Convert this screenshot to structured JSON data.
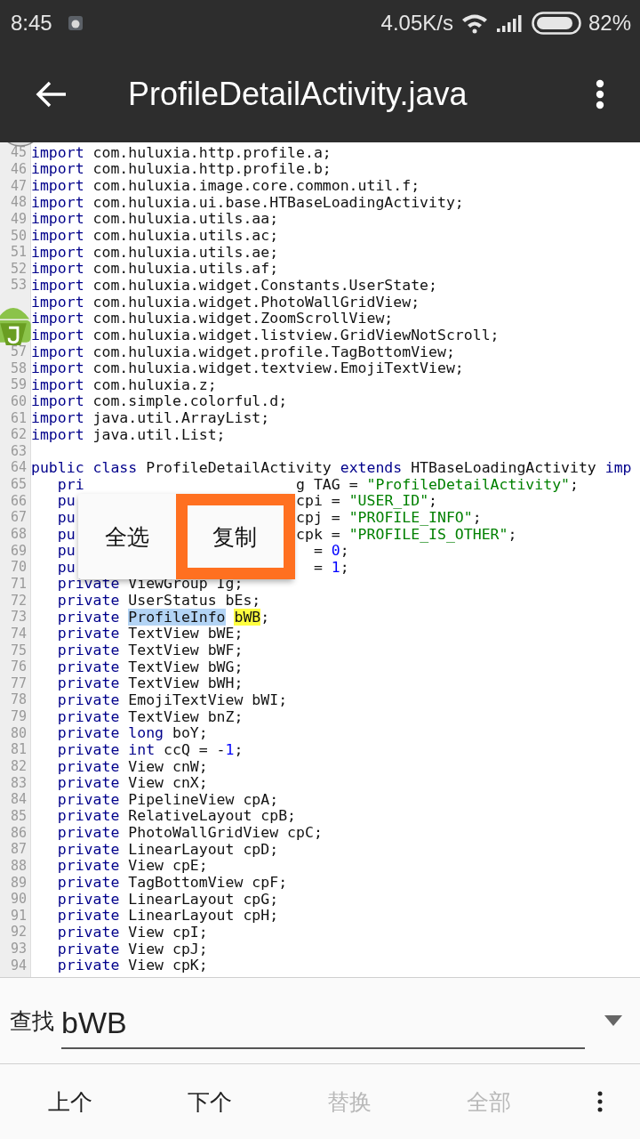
{
  "status_bar": {
    "time": "8:45",
    "speed": "4.05K/s",
    "battery": "82%"
  },
  "toolbar": {
    "title": "ProfileDetailActivity.java"
  },
  "code": {
    "lines": [
      {
        "number": "45",
        "tokens": [
          {
            "kind": "kw",
            "text": "import"
          },
          {
            "kind": "plain",
            "text": " com.huluxia.http.profile.a;"
          }
        ]
      },
      {
        "number": "46",
        "tokens": [
          {
            "kind": "kw",
            "text": "import"
          },
          {
            "kind": "plain",
            "text": " com.huluxia.http.profile.b;"
          }
        ]
      },
      {
        "number": "47",
        "tokens": [
          {
            "kind": "kw",
            "text": "import"
          },
          {
            "kind": "plain",
            "text": " com.huluxia.image.core.common.util.f;"
          }
        ]
      },
      {
        "number": "48",
        "tokens": [
          {
            "kind": "kw",
            "text": "import"
          },
          {
            "kind": "plain",
            "text": " com.huluxia.ui.base.HTBaseLoadingActivity;"
          }
        ]
      },
      {
        "number": "49",
        "tokens": [
          {
            "kind": "kw",
            "text": "import"
          },
          {
            "kind": "plain",
            "text": " com.huluxia.utils.aa;"
          }
        ]
      },
      {
        "number": "50",
        "tokens": [
          {
            "kind": "kw",
            "text": "import"
          },
          {
            "kind": "plain",
            "text": " com.huluxia.utils.ac;"
          }
        ]
      },
      {
        "number": "51",
        "tokens": [
          {
            "kind": "kw",
            "text": "import"
          },
          {
            "kind": "plain",
            "text": " com.huluxia.utils.ae;"
          }
        ]
      },
      {
        "number": "52",
        "tokens": [
          {
            "kind": "kw",
            "text": "import"
          },
          {
            "kind": "plain",
            "text": " com.huluxia.utils.af;"
          }
        ]
      },
      {
        "number": "53",
        "tokens": [
          {
            "kind": "kw",
            "text": "import"
          },
          {
            "kind": "plain",
            "text": " com.huluxia.widget.Constants.UserState;"
          }
        ]
      },
      {
        "tokens": [
          {
            "kind": "kw",
            "text": "import"
          },
          {
            "kind": "plain",
            "text": " com.huluxia.widget.PhotoWallGridView;"
          }
        ]
      },
      {
        "tokens": [
          {
            "kind": "kw",
            "text": "import"
          },
          {
            "kind": "plain",
            "text": " com.huluxia.widget.ZoomScrollView;"
          }
        ]
      },
      {
        "tokens": [
          {
            "kind": "kw",
            "text": "import"
          },
          {
            "kind": "plain",
            "text": " com.huluxia.widget.listview.GridViewNotScroll;"
          }
        ]
      },
      {
        "number": "57",
        "tokens": [
          {
            "kind": "kw",
            "text": "import"
          },
          {
            "kind": "plain",
            "text": " com.huluxia.widget.profile.TagBottomView;"
          }
        ]
      },
      {
        "number": "58",
        "tokens": [
          {
            "kind": "kw",
            "text": "import"
          },
          {
            "kind": "plain",
            "text": " com.huluxia.widget.textview.EmojiTextView;"
          }
        ]
      },
      {
        "number": "59",
        "tokens": [
          {
            "kind": "kw",
            "text": "import"
          },
          {
            "kind": "plain",
            "text": " com.huluxia.z;"
          }
        ]
      },
      {
        "number": "60",
        "tokens": [
          {
            "kind": "kw",
            "text": "import"
          },
          {
            "kind": "plain",
            "text": " com.simple.colorful.d;"
          }
        ]
      },
      {
        "number": "61",
        "tokens": [
          {
            "kind": "kw",
            "text": "import"
          },
          {
            "kind": "plain",
            "text": " java.util.ArrayList;"
          }
        ]
      },
      {
        "number": "62",
        "tokens": [
          {
            "kind": "kw",
            "text": "import"
          },
          {
            "kind": "plain",
            "text": " java.util.List;"
          }
        ]
      },
      {
        "number": "63"
      },
      {
        "number": "64",
        "tokens": [
          {
            "kind": "kw",
            "text": "public class"
          },
          {
            "kind": "plain",
            "text": " ProfileDetailActivity "
          },
          {
            "kind": "kw",
            "text": "extends"
          },
          {
            "kind": "plain",
            "text": " HTBaseLoadingActivity "
          },
          {
            "kind": "kw",
            "text": "imp"
          }
        ]
      },
      {
        "number": "65",
        "tokens": [
          {
            "kind": "kw",
            "text": "   pri"
          },
          {
            "kind": "plain",
            "text": "                        g TAG = "
          },
          {
            "kind": "str",
            "text": "\"ProfileDetailActivity\""
          },
          {
            "kind": "plain",
            "text": ";"
          }
        ]
      },
      {
        "number": "66",
        "tokens": [
          {
            "kind": "kw",
            "text": "   pu"
          },
          {
            "kind": "plain",
            "text": "                         cpi = "
          },
          {
            "kind": "str",
            "text": "\"USER_ID\""
          },
          {
            "kind": "plain",
            "text": ";"
          }
        ]
      },
      {
        "number": "67",
        "tokens": [
          {
            "kind": "kw",
            "text": "   pu"
          },
          {
            "kind": "plain",
            "text": "                         cpj = "
          },
          {
            "kind": "str",
            "text": "\"PROFILE_INFO\""
          },
          {
            "kind": "plain",
            "text": ";"
          }
        ]
      },
      {
        "number": "68",
        "tokens": [
          {
            "kind": "kw",
            "text": "   pu"
          },
          {
            "kind": "plain",
            "text": "                         cpk = "
          },
          {
            "kind": "str",
            "text": "\"PROFILE_IS_OTHER\""
          },
          {
            "kind": "plain",
            "text": ";"
          }
        ]
      },
      {
        "number": "69",
        "tokens": [
          {
            "kind": "kw",
            "text": "   pu"
          },
          {
            "kind": "plain",
            "text": "                           = "
          },
          {
            "kind": "num",
            "text": "0"
          },
          {
            "kind": "plain",
            "text": ";"
          }
        ]
      },
      {
        "number": "70",
        "tokens": [
          {
            "kind": "kw",
            "text": "   pu"
          },
          {
            "kind": "plain",
            "text": "                           = "
          },
          {
            "kind": "num",
            "text": "1"
          },
          {
            "kind": "plain",
            "text": ";"
          }
        ]
      },
      {
        "number": "71",
        "tokens": [
          {
            "kind": "kw",
            "text": "   private"
          },
          {
            "kind": "plain",
            "text": " ViewGroup Ig;"
          }
        ]
      },
      {
        "number": "72",
        "tokens": [
          {
            "kind": "kw",
            "text": "   private"
          },
          {
            "kind": "plain",
            "text": " UserStatus bEs;"
          }
        ]
      },
      {
        "number": "73",
        "tokens": [
          {
            "kind": "kw",
            "text": "   private "
          },
          {
            "kind": "selected",
            "text": "ProfileInfo"
          },
          {
            "kind": "match",
            "text": "bWB"
          },
          {
            "kind": "plain",
            "text": ";"
          }
        ]
      },
      {
        "number": "74",
        "tokens": [
          {
            "kind": "kw",
            "text": "   private"
          },
          {
            "kind": "plain",
            "text": " TextView bWE;"
          }
        ]
      },
      {
        "number": "75",
        "tokens": [
          {
            "kind": "kw",
            "text": "   private"
          },
          {
            "kind": "plain",
            "text": " TextView bWF;"
          }
        ]
      },
      {
        "number": "76",
        "tokens": [
          {
            "kind": "kw",
            "text": "   private"
          },
          {
            "kind": "plain",
            "text": " TextView bWG;"
          }
        ]
      },
      {
        "number": "77",
        "tokens": [
          {
            "kind": "kw",
            "text": "   private"
          },
          {
            "kind": "plain",
            "text": " TextView bWH;"
          }
        ]
      },
      {
        "number": "78",
        "tokens": [
          {
            "kind": "kw",
            "text": "   private"
          },
          {
            "kind": "plain",
            "text": " EmojiTextView bWI;"
          }
        ]
      },
      {
        "number": "79",
        "tokens": [
          {
            "kind": "kw",
            "text": "   private"
          },
          {
            "kind": "plain",
            "text": " TextView bnZ;"
          }
        ]
      },
      {
        "number": "80",
        "tokens": [
          {
            "kind": "kw",
            "text": "   private long"
          },
          {
            "kind": "plain",
            "text": " boY;"
          }
        ]
      },
      {
        "number": "81",
        "tokens": [
          {
            "kind": "kw",
            "text": "   private int"
          },
          {
            "kind": "plain",
            "text": " ccQ = -"
          },
          {
            "kind": "num",
            "text": "1"
          },
          {
            "kind": "plain",
            "text": ";"
          }
        ]
      },
      {
        "number": "82",
        "tokens": [
          {
            "kind": "kw",
            "text": "   private"
          },
          {
            "kind": "plain",
            "text": " View cnW;"
          }
        ]
      },
      {
        "number": "83",
        "tokens": [
          {
            "kind": "kw",
            "text": "   private"
          },
          {
            "kind": "plain",
            "text": " View cnX;"
          }
        ]
      },
      {
        "number": "84",
        "tokens": [
          {
            "kind": "kw",
            "text": "   private"
          },
          {
            "kind": "plain",
            "text": " PipelineView cpA;"
          }
        ]
      },
      {
        "number": "85",
        "tokens": [
          {
            "kind": "kw",
            "text": "   private"
          },
          {
            "kind": "plain",
            "text": " RelativeLayout cpB;"
          }
        ]
      },
      {
        "number": "86",
        "tokens": [
          {
            "kind": "kw",
            "text": "   private"
          },
          {
            "kind": "plain",
            "text": " PhotoWallGridView cpC;"
          }
        ]
      },
      {
        "number": "87",
        "tokens": [
          {
            "kind": "kw",
            "text": "   private"
          },
          {
            "kind": "plain",
            "text": " LinearLayout cpD;"
          }
        ]
      },
      {
        "number": "88",
        "tokens": [
          {
            "kind": "kw",
            "text": "   private"
          },
          {
            "kind": "plain",
            "text": " View cpE;"
          }
        ]
      },
      {
        "number": "89",
        "tokens": [
          {
            "kind": "kw",
            "text": "   private"
          },
          {
            "kind": "plain",
            "text": " TagBottomView cpF;"
          }
        ]
      },
      {
        "number": "90",
        "tokens": [
          {
            "kind": "kw",
            "text": "   private"
          },
          {
            "kind": "plain",
            "text": " LinearLayout cpG;"
          }
        ]
      },
      {
        "number": "91",
        "tokens": [
          {
            "kind": "kw",
            "text": "   private"
          },
          {
            "kind": "plain",
            "text": " LinearLayout cpH;"
          }
        ]
      },
      {
        "number": "92",
        "tokens": [
          {
            "kind": "kw",
            "text": "   private"
          },
          {
            "kind": "plain",
            "text": " View cpI;"
          }
        ]
      },
      {
        "number": "93",
        "tokens": [
          {
            "kind": "kw",
            "text": "   private"
          },
          {
            "kind": "plain",
            "text": " View cpJ;"
          }
        ]
      },
      {
        "number": "94",
        "tokens": [
          {
            "kind": "kw",
            "text": "   private"
          },
          {
            "kind": "plain",
            "text": " View cpK;"
          }
        ]
      }
    ]
  },
  "context_menu": {
    "items": [
      {
        "label": "全选",
        "highlighted": false
      },
      {
        "label": "复制",
        "highlighted": true
      }
    ]
  },
  "find_bar": {
    "label": "查找",
    "value": "bWB"
  },
  "actions": [
    {
      "label": "上个",
      "disabled": false
    },
    {
      "label": "下个",
      "disabled": false
    },
    {
      "label": "替换",
      "disabled": true
    },
    {
      "label": "全部",
      "disabled": true
    }
  ]
}
